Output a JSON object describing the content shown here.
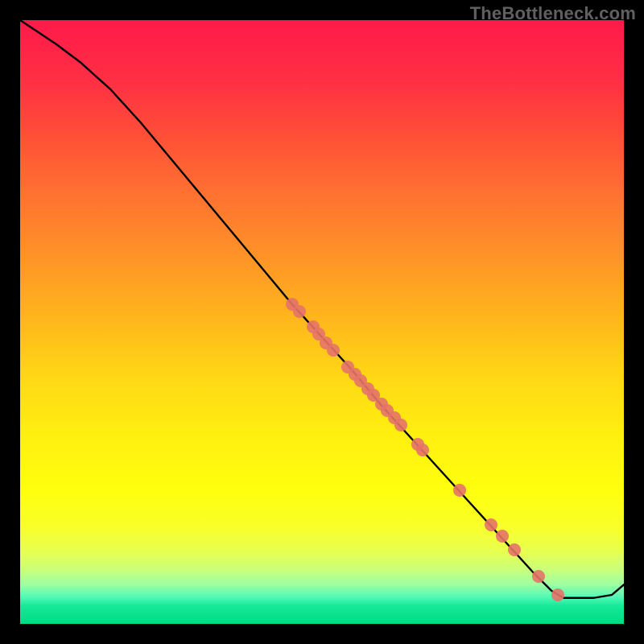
{
  "watermark": "TheBottleneck.com",
  "chart_data": {
    "type": "line",
    "title": "",
    "xlabel": "",
    "ylabel": "",
    "xlim": [
      0,
      100
    ],
    "ylim": [
      0,
      100
    ],
    "grid": false,
    "background_gradient": [
      {
        "stop": 0.0,
        "color": "#ff1a4a"
      },
      {
        "stop": 0.1,
        "color": "#ff2f44"
      },
      {
        "stop": 0.2,
        "color": "#ff5236"
      },
      {
        "stop": 0.3,
        "color": "#ff7530"
      },
      {
        "stop": 0.4,
        "color": "#ff9626"
      },
      {
        "stop": 0.5,
        "color": "#ffb81b"
      },
      {
        "stop": 0.6,
        "color": "#ffda15"
      },
      {
        "stop": 0.7,
        "color": "#fff20f"
      },
      {
        "stop": 0.78,
        "color": "#ffff0e"
      },
      {
        "stop": 0.84,
        "color": "#f8ff2a"
      },
      {
        "stop": 0.88,
        "color": "#e8ff50"
      },
      {
        "stop": 0.91,
        "color": "#caff7a"
      },
      {
        "stop": 0.935,
        "color": "#9dffa2"
      },
      {
        "stop": 0.955,
        "color": "#55f9b6"
      },
      {
        "stop": 0.97,
        "color": "#17e999"
      },
      {
        "stop": 1.0,
        "color": "#00db82"
      }
    ],
    "series": [
      {
        "name": "bottleneck-curve",
        "color": "#000000",
        "x": [
          0,
          3,
          6,
          10,
          15,
          20,
          25,
          30,
          35,
          40,
          45,
          50,
          55,
          60,
          65,
          70,
          75,
          80,
          85,
          88,
          90,
          95,
          98,
          100
        ],
        "y": [
          100,
          98,
          96,
          93,
          88.5,
          83,
          77,
          71,
          65,
          59,
          53,
          47.5,
          42,
          36,
          30.5,
          25,
          19.5,
          14,
          8.5,
          5.5,
          4.3,
          4.3,
          4.8,
          6.5
        ]
      }
    ],
    "markers": {
      "name": "highlighted-points",
      "color": "#e57368",
      "points": [
        {
          "x": 45.0,
          "y": 53.0
        },
        {
          "x": 46.2,
          "y": 51.7
        },
        {
          "x": 48.5,
          "y": 49.2
        },
        {
          "x": 49.5,
          "y": 48.0
        },
        {
          "x": 50.7,
          "y": 46.6
        },
        {
          "x": 51.8,
          "y": 45.4
        },
        {
          "x": 54.3,
          "y": 42.6
        },
        {
          "x": 55.5,
          "y": 41.3
        },
        {
          "x": 56.4,
          "y": 40.3
        },
        {
          "x": 57.6,
          "y": 39.0
        },
        {
          "x": 58.5,
          "y": 37.9
        },
        {
          "x": 59.9,
          "y": 36.4
        },
        {
          "x": 60.8,
          "y": 35.4
        },
        {
          "x": 62.0,
          "y": 34.1
        },
        {
          "x": 63.0,
          "y": 32.9
        },
        {
          "x": 65.8,
          "y": 29.8
        },
        {
          "x": 66.7,
          "y": 28.8
        },
        {
          "x": 72.8,
          "y": 22.1
        },
        {
          "x": 78.0,
          "y": 16.4
        },
        {
          "x": 79.8,
          "y": 14.5
        },
        {
          "x": 81.8,
          "y": 12.3
        },
        {
          "x": 85.8,
          "y": 7.9
        },
        {
          "x": 89.0,
          "y": 4.8
        }
      ]
    }
  }
}
